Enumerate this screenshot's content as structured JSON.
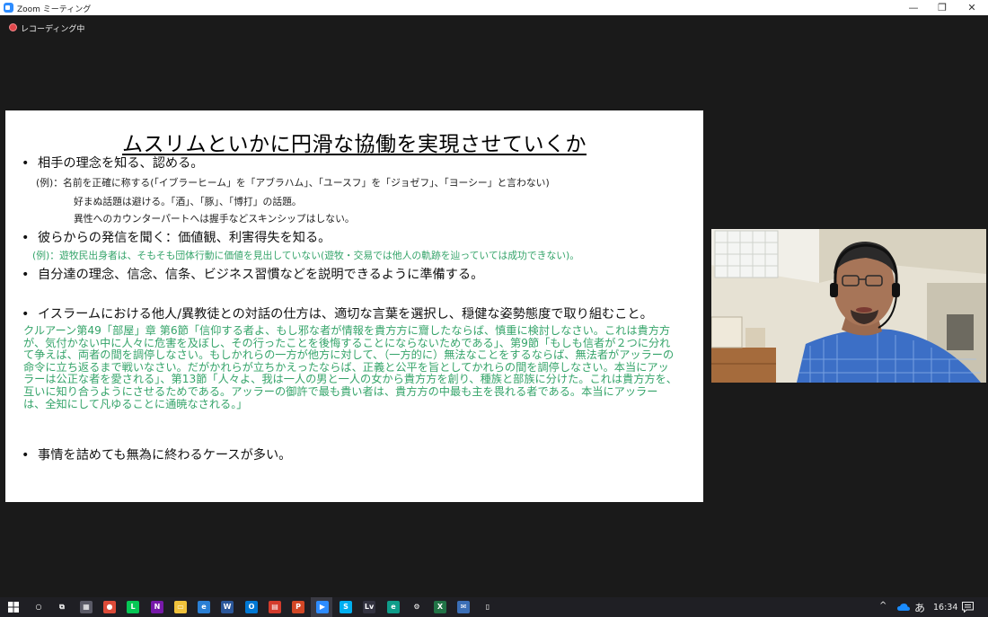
{
  "window": {
    "title": "Zoom ミーティング"
  },
  "controls": {
    "minimize": "—",
    "maximize": "❐",
    "close": "✕"
  },
  "recording": {
    "label": "レコーディング中"
  },
  "slide": {
    "title": "ムスリムといかに円滑な協働を実現させていくか",
    "bullet_marker": "•",
    "bullet1": "相手の理念を知る、認める。",
    "bullet1_sub1": "(例)：名前を正確に称する(「イブラーヒーム」を「アブラハム」、「ユースフ」を「ジョゼフ」、「ヨーシー」と言わない)",
    "bullet1_sub2": "好まぬ話題は避ける。「酒」、「豚」、「博打」の話題。",
    "bullet1_sub3": "異性へのカウンターパートへは握手などスキンシップはしない。",
    "bullet2": "彼らからの発信を聞く：価値観、利害得失を知る。",
    "bullet2_sub": "(例)：遊牧民出身者は、そもそも団体行動に価値を見出していない(遊牧・交易では他人の軌跡を辿っていては成功できない)。",
    "bullet3": "自分達の理念、信念、信条、ビジネス習慣などを説明できるように準備する。",
    "bullet4": "イスラームにおける他人/異教徒との対話の仕方は、適切な言葉を選択し、穏健な姿勢態度で取り組むこと。",
    "quran": "クルアーン第49「部屋」章 第6節「信仰する者よ、もし邪な者が情報を貴方方に齎したならば、慎重に検討しなさい。これは貴方方が、気付かない中に人々に危害を及ぼし、その行ったことを後悔することにならないためである」、第9節「もしも信者が２つに分れて争えば、両者の間を調停しなさい。もしかれらの一方が他方に対して、（一方的に）無法なことをするならば、無法者がアッラーの命令に立ち返るまで戦いなさい。だがかれらが立ちかえったならば、正義と公平を旨としてかれらの間を調停しなさい。本当にアッラーは公正な者を愛される」、第13節「人々よ、我は一人の男と一人の女から貴方方を創り、種族と部族に分けた。これは貴方方を、互いに知り合うようにさせるためである。アッラーの御許で最も貴い者は、貴方方の中最も主を畏れる者である。本当にアッラーは、全知にして凡ゆることに通暁なされる。」",
    "bullet5": "事情を詰めても無為に終わるケースが多い。"
  },
  "taskbar": {
    "apps": [
      {
        "icon": "search-icon",
        "color": "#1f1f24",
        "glyph": "○"
      },
      {
        "icon": "task-view-icon",
        "color": "#1f1f24",
        "glyph": "⧉"
      },
      {
        "icon": "calculator-icon",
        "color": "#5a5a66",
        "glyph": "▦"
      },
      {
        "icon": "chrome-icon",
        "color": "#dd4b39",
        "glyph": "●"
      },
      {
        "icon": "line-icon",
        "color": "#06c755",
        "glyph": "L"
      },
      {
        "icon": "onenote-icon",
        "color": "#7719aa",
        "glyph": "N"
      },
      {
        "icon": "file-explorer-icon",
        "color": "#f0c23b",
        "glyph": "▭"
      },
      {
        "icon": "edge-legacy-icon",
        "color": "#2a7fd4",
        "glyph": "e"
      },
      {
        "icon": "word-icon",
        "color": "#2b579a",
        "glyph": "W"
      },
      {
        "icon": "outlook-icon",
        "color": "#0078d4",
        "glyph": "O"
      },
      {
        "icon": "calendar-icon",
        "color": "#d33b2c",
        "glyph": "▤"
      },
      {
        "icon": "powerpoint-icon",
        "color": "#d24726",
        "glyph": "P"
      },
      {
        "icon": "zoom-icon",
        "color": "#2d8cff",
        "glyph": "▶"
      },
      {
        "icon": "skype-icon",
        "color": "#00aff0",
        "glyph": "S"
      },
      {
        "icon": "app-lv-icon",
        "color": "#333340",
        "glyph": "Lv"
      },
      {
        "icon": "edge-icon",
        "color": "#0f9d8a",
        "glyph": "e"
      },
      {
        "icon": "settings-icon",
        "color": "#1f1f24",
        "glyph": "⚙"
      },
      {
        "icon": "excel-icon",
        "color": "#217346",
        "glyph": "X"
      },
      {
        "icon": "mail-icon",
        "color": "#3b6fb6",
        "glyph": "✉"
      },
      {
        "icon": "document-icon",
        "color": "#1f1f24",
        "glyph": "▯"
      }
    ],
    "tray": {
      "chevron": "^",
      "ime": "あ",
      "time": "16:34"
    }
  }
}
